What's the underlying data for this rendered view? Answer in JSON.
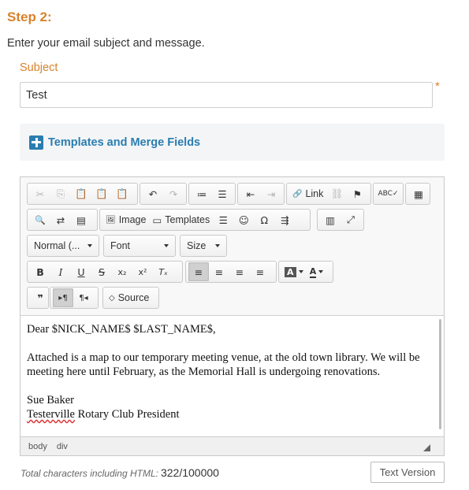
{
  "step": {
    "title": "Step 2:",
    "description": "Enter your email subject and message."
  },
  "subject": {
    "label": "Subject",
    "value": "Test",
    "required_marker": "*"
  },
  "templates": {
    "label": "Templates and Merge Fields"
  },
  "toolbar": {
    "row1": {
      "cut": "✂",
      "copy": "⎘",
      "paste": "📋",
      "paste_text": "📋",
      "paste_word": "📋",
      "undo": "↶",
      "redo": "↷",
      "numbered_list": "≔",
      "bulleted_list": "☰",
      "outdent": "⇤",
      "indent": "⇥",
      "link_icon": "🔗",
      "link_label": "Link",
      "unlink": "⛓",
      "anchor": "⚑",
      "spellcheck": "ABC✓",
      "table": "▦"
    },
    "row2": {
      "find": "🔍",
      "replace": "⇄",
      "select_all": "▤",
      "image_icon": "🖼",
      "image_label": "Image",
      "templates_icon": "▭",
      "templates_label": "Templates",
      "hr": "☰",
      "smiley": "☺",
      "special_char": "Ω",
      "page_break": "⇶",
      "show_blocks": "▥",
      "maximize": "⤢"
    },
    "format_combo": "Normal (...",
    "font_combo": "Font",
    "size_combo": "Size",
    "row4": {
      "bold": "B",
      "italic": "I",
      "underline": "U",
      "strike": "S",
      "subscript": "x₂",
      "superscript": "x²",
      "remove_format": "Tₓ",
      "align_left": "≡",
      "align_center": "≡",
      "align_right": "≡",
      "justify": "≡",
      "text_color": "A",
      "bg_color": "A"
    },
    "row5": {
      "blockquote": "❞",
      "ltr": "▸¶",
      "rtl": "¶◂",
      "source_icon": "◇",
      "source_label": "Source"
    }
  },
  "content": {
    "line1": "Dear $NICK_NAME$ $LAST_NAME$,",
    "para2": "Attached is a map to our temporary meeting venue, at the old town library. We will be meeting here until February, as the Memorial Hall is undergoing renovations.",
    "signature_name": "Sue Baker",
    "signature_org_misspelled": "Testerville",
    "signature_org_rest": " Rotary Club President"
  },
  "statusbar": {
    "path": [
      "body",
      "div"
    ]
  },
  "footer": {
    "char_label": "Total characters including HTML:",
    "char_count": "322/100000",
    "text_version_button": "Text Version"
  }
}
